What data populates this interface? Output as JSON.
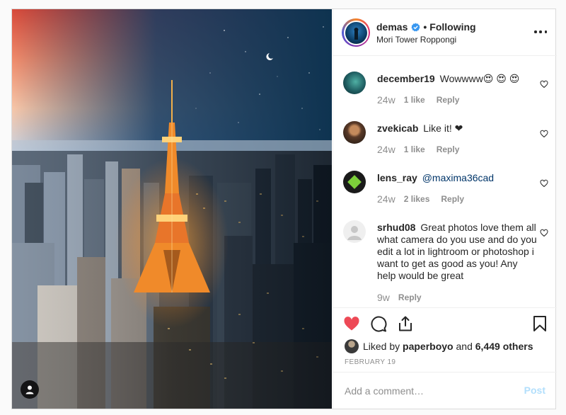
{
  "post": {
    "author": {
      "username": "demas",
      "verified": true,
      "follow_status": "Following",
      "separator": "•",
      "location": "Mori Tower Roppongi"
    },
    "comments": [
      {
        "username": "december19",
        "text": "Wowwww😍 😍 😍",
        "age": "24w",
        "likes": "1 like",
        "reply": "Reply",
        "mention": ""
      },
      {
        "username": "zvekicab",
        "text": "Like it! ❤",
        "age": "24w",
        "likes": "1 like",
        "reply": "Reply",
        "mention": ""
      },
      {
        "username": "lens_ray",
        "text": "",
        "mention": "@maxima36cad",
        "age": "24w",
        "likes": "2 likes",
        "reply": "Reply"
      },
      {
        "username": "srhud08",
        "text": "Great photos love them all what camera do you use and do you edit a lot in lightroom or photoshop i want to get as good as you! Any help would be great",
        "age": "9w",
        "likes": "",
        "reply": "Reply",
        "mention": ""
      }
    ],
    "liked_by": {
      "prefix": "Liked by",
      "user": "paperboyo",
      "connector": "and",
      "others": "6,449 others"
    },
    "date": "FEBRUARY 19",
    "add_comment": {
      "placeholder": "Add a comment…",
      "post_label": "Post"
    },
    "icons": {
      "like": "heart-filled-icon",
      "comment": "comment-bubble-icon",
      "share": "share-icon",
      "save": "bookmark-icon",
      "more": "more-options-icon",
      "tag": "user-tag-icon"
    },
    "colors": {
      "like": "#ed4956",
      "link": "#003569",
      "verified": "#3897f0",
      "post_disabled": "#b2dffc",
      "muted": "#8e8e8e"
    }
  }
}
